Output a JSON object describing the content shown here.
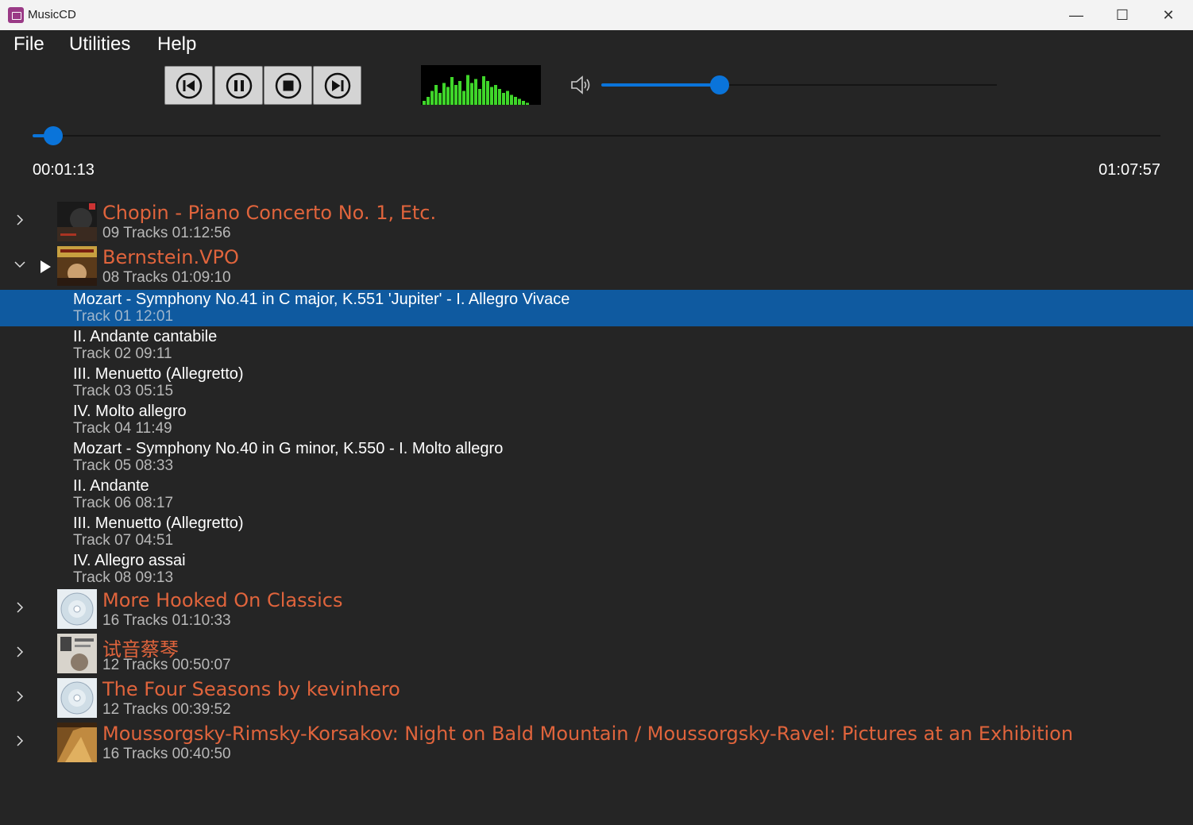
{
  "window": {
    "title": "MusicCD",
    "minimize_glyph": "—",
    "maximize_glyph": "☐",
    "close_glyph": "✕"
  },
  "menu": [
    "File",
    "Utilities",
    "Help"
  ],
  "transport": {
    "buttons": [
      "previous-icon",
      "pause-icon",
      "stop-icon",
      "next-icon"
    ]
  },
  "visualizer": {
    "bars": [
      0.1,
      0.2,
      0.35,
      0.5,
      0.3,
      0.55,
      0.45,
      0.7,
      0.5,
      0.6,
      0.35,
      0.75,
      0.55,
      0.65,
      0.4,
      0.72,
      0.6,
      0.45,
      0.5,
      0.4,
      0.3,
      0.35,
      0.25,
      0.2,
      0.15,
      0.1,
      0.05
    ]
  },
  "volume": {
    "icon": "speaker-icon",
    "level": 0.3
  },
  "progress": {
    "elapsed": "00:01:13",
    "total": "01:07:57",
    "fraction": 0.018
  },
  "colors": {
    "accent": "#0a74da",
    "album_title": "#e0643c",
    "selected_row": "#0f5aa0"
  },
  "albums": [
    {
      "title": "Chopin - Piano Concerto No. 1, Etc.",
      "meta": "09 Tracks  01:12:56",
      "expanded": false,
      "playing": false,
      "cover": "photo"
    },
    {
      "title": "Bernstein.VPO",
      "meta": "08 Tracks  01:09:10",
      "expanded": true,
      "playing": true,
      "cover": "photo",
      "tracks": [
        {
          "title": "Mozart - Symphony No.41 in C major, K.551 'Jupiter' - I. Allegro Vivace",
          "meta": "Track 01  12:01",
          "selected": true
        },
        {
          "title": "II. Andante cantabile",
          "meta": "Track 02  09:11"
        },
        {
          "title": "III. Menuetto (Allegretto)",
          "meta": "Track 03  05:15"
        },
        {
          "title": "IV. Molto allegro",
          "meta": "Track 04  11:49"
        },
        {
          "title": "Mozart - Symphony No.40 in G minor, K.550 - I. Molto allegro",
          "meta": "Track 05  08:33"
        },
        {
          "title": "II. Andante",
          "meta": "Track 06  08:17"
        },
        {
          "title": "III. Menuetto (Allegretto)",
          "meta": "Track 07  04:51"
        },
        {
          "title": "IV. Allegro assai",
          "meta": "Track 08  09:13"
        }
      ]
    },
    {
      "title": "More Hooked On Classics",
      "meta": "16 Tracks  01:10:33",
      "expanded": false,
      "playing": false,
      "cover": "cd"
    },
    {
      "title": "试音蔡琴",
      "meta": "12 Tracks  00:50:07",
      "expanded": false,
      "playing": false,
      "cover": "photo"
    },
    {
      "title": "The Four Seasons by kevinhero",
      "meta": "12 Tracks  00:39:52",
      "expanded": false,
      "playing": false,
      "cover": "cd"
    },
    {
      "title": "Moussorgsky-Rimsky-Korsakov: Night on Bald Mountain / Moussorgsky-Ravel: Pictures at an Exhibition",
      "meta": "16 Tracks  00:40:50",
      "expanded": false,
      "playing": false,
      "cover": "photo"
    }
  ]
}
